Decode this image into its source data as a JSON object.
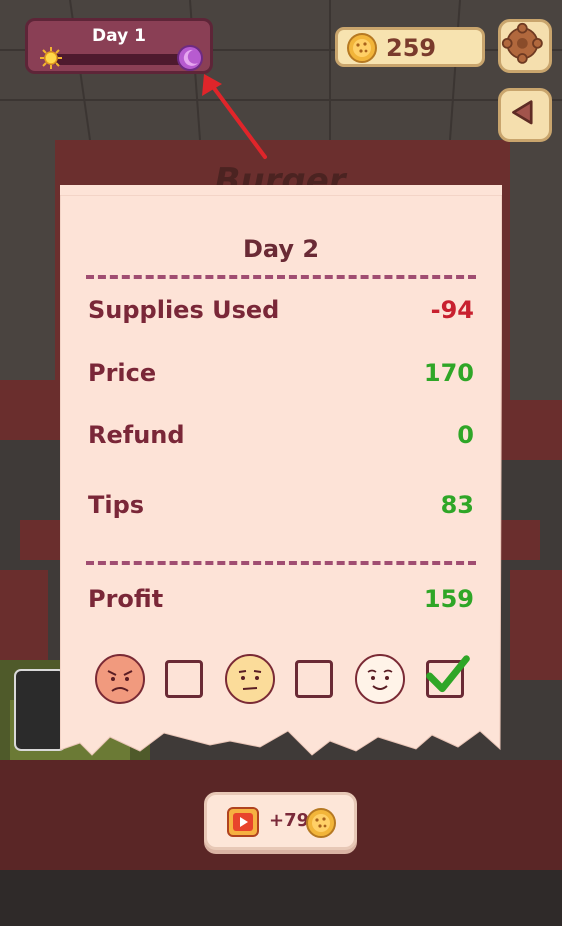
{
  "hud": {
    "day_label": "Day 1",
    "coins": "259",
    "icons": [
      "sun-icon",
      "moon-icon",
      "coin-icon",
      "gear-cookie-icon",
      "back-arrow-icon"
    ]
  },
  "background": {
    "sign_text": "Burger"
  },
  "receipt": {
    "title": "Day 2",
    "rows": [
      {
        "label": "Supplies Used",
        "value": "-94"
      },
      {
        "label": "Price",
        "value": "170"
      },
      {
        "label": "Refund",
        "value": "0"
      },
      {
        "label": "Tips",
        "value": "83"
      }
    ],
    "profit_label": "Profit",
    "profit_value": "159",
    "ratings": {
      "angry_checked": false,
      "neutral_checked": false,
      "happy_checked": true
    }
  },
  "reward": {
    "label": "+79",
    "icons": [
      "video-play-icon",
      "coin-icon"
    ]
  },
  "colors": {
    "negative": "#c8202f",
    "positive": "#2fa627",
    "receipt_bg": "#fde3d7",
    "hud_purple": "#8a3f55"
  }
}
